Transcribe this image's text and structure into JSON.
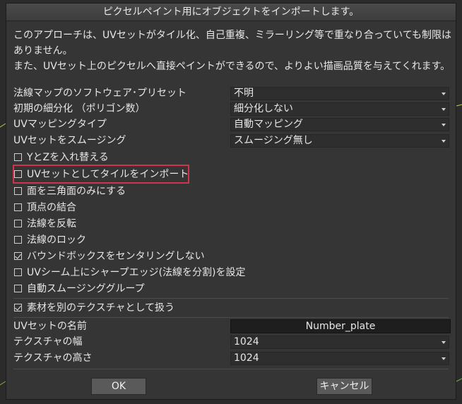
{
  "dialog": {
    "title": "ピクセルペイント用にオブジェクトをインポートします。",
    "description": [
      "このアプローチは、UVセットがタイル化、自己重複、ミラーリング等で重なり合っていても制限は",
      "ありません。",
      "また、UVセット上のピクセルへ直接ペイントができるので、よりよい描画品質を与えてくれます。"
    ]
  },
  "dropdowns": [
    {
      "label": "法線マップのソフトウェア･プリセット",
      "value": "不明"
    },
    {
      "label": "初期の細分化 （ポリゴン数）",
      "value": "細分化しない"
    },
    {
      "label": "UVマッピングタイプ",
      "value": "自動マッピング"
    },
    {
      "label": "UVセットをスムージング",
      "value": "スムージング無し"
    }
  ],
  "checkboxes": [
    {
      "label": "YとZを入れ替える",
      "checked": false
    },
    {
      "label": "UVセットとしてタイルをインポート",
      "checked": false
    },
    {
      "label": "面を三角面のみにする",
      "checked": false
    },
    {
      "label": "頂点の結合",
      "checked": false
    },
    {
      "label": "法線を反転",
      "checked": false
    },
    {
      "label": "法線のロック",
      "checked": false
    },
    {
      "label": "バウンドボックスをセンタリングしない",
      "checked": true
    },
    {
      "label": "UVシーム上にシャープエッジ(法線を分割)を設定",
      "checked": false
    },
    {
      "label": "自動スムージンググループ",
      "checked": false
    }
  ],
  "material_checkbox": {
    "label": "素材を別のテクスチャとして扱う",
    "checked": true
  },
  "uvset_name": {
    "label": "UVセットの名前",
    "value": "Number_plate"
  },
  "texture_width": {
    "label": "テクスチャの幅",
    "value": "1024"
  },
  "texture_height": {
    "label": "テクスチャの高さ",
    "value": "1024"
  },
  "buttons": {
    "ok": "OK",
    "cancel": "キャンセル"
  },
  "colors": {
    "highlight": "#d0344a",
    "dialog_bg": "#353535"
  }
}
